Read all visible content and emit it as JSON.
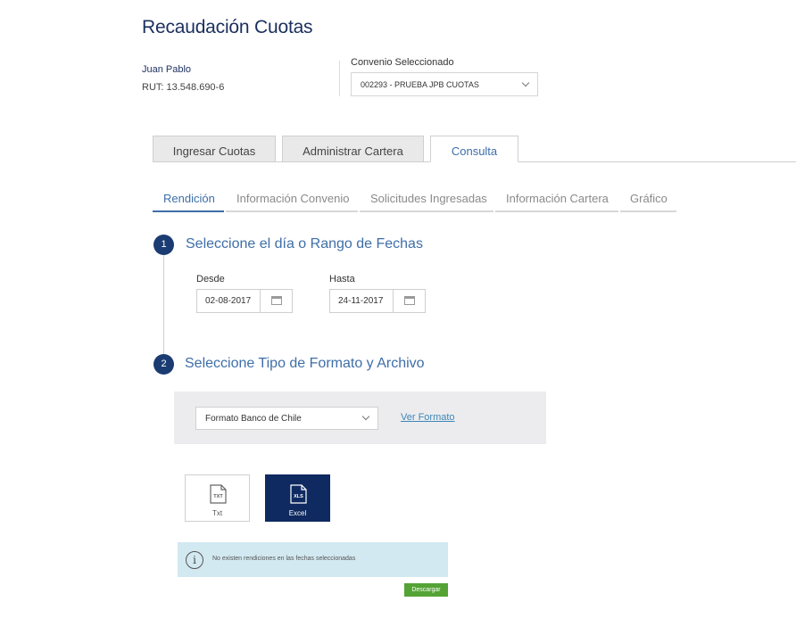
{
  "header": {
    "title": "Recaudación Cuotas",
    "user_name": "Juan Pablo",
    "user_rut": "RUT: 13.548.690-6",
    "convenio_label": "Convenio Seleccionado",
    "convenio_value": "002293 - PRUEBA JPB CUOTAS"
  },
  "tabs": [
    {
      "label": "Ingresar Cuotas",
      "active": false
    },
    {
      "label": "Administrar Cartera",
      "active": false
    },
    {
      "label": "Consulta",
      "active": true
    }
  ],
  "subtabs": [
    {
      "label": "Rendición",
      "active": true
    },
    {
      "label": "Información Convenio",
      "active": false
    },
    {
      "label": "Solicitudes Ingresadas",
      "active": false
    },
    {
      "label": "Información Cartera",
      "active": false
    },
    {
      "label": "Gráfico",
      "active": false
    }
  ],
  "step1": {
    "number": "1",
    "title": "Seleccione el día o Rango de Fechas",
    "desde_label": "Desde",
    "desde_value": "02-08-2017",
    "hasta_label": "Hasta",
    "hasta_value": "24-11-2017"
  },
  "step2": {
    "number": "2",
    "title": "Seleccione Tipo de Formato y Archivo",
    "format_value": "Formato Banco de Chile",
    "ver_formato": "Ver Formato"
  },
  "files": {
    "txt_label": "Txt",
    "txt_icon_text": "TXT",
    "xls_label": "Excel",
    "xls_icon_text": "XLS"
  },
  "info": {
    "message": "No existen rendiciones en las fechas seleccionadas",
    "icon_glyph": "i"
  },
  "actions": {
    "download_label": "Descargar"
  },
  "colors": {
    "primary_navy": "#1b3c72",
    "accent_blue": "#3e6ea8",
    "info_bg": "#d2e9f1",
    "download_green": "#54a335",
    "excel_bg": "#0f2a60"
  }
}
